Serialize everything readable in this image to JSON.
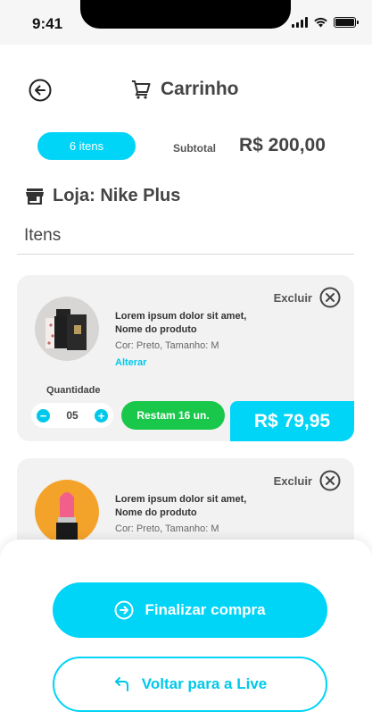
{
  "status_bar": {
    "time": "9:41"
  },
  "header": {
    "title": "Carrinho",
    "back_icon": "arrow-left-circle-icon",
    "cart_icon": "shopping-cart-icon"
  },
  "summary": {
    "items_count": "6 itens",
    "subtotal_label": "Subtotal",
    "subtotal_value": "R$ 200,00"
  },
  "store": {
    "name": "Loja: Nike Plus",
    "icon": "store-icon"
  },
  "items_heading": "Itens",
  "colors": {
    "accent": "#00d4f7",
    "success": "#19c84a",
    "card_bg": "#f2f2f2",
    "text": "#444444"
  },
  "cart_items": [
    {
      "name": "Lorem ipsum dolor sit amet, Nome do produto",
      "variant": "Cor: Preto, Tamanho: M",
      "edit_label": "Alterar",
      "remove_label": "Excluir",
      "quantity_label": "Quantidade",
      "quantity": "05",
      "stock_label": "Restam 16 un.",
      "price": "R$ 79,95",
      "image": "perfume-box-product"
    },
    {
      "name": "Lorem ipsum dolor sit amet, Nome do produto",
      "variant": "Cor: Preto, Tamanho: M",
      "remove_label": "Excluir",
      "image": "lipstick-product"
    }
  ],
  "actions": {
    "checkout_label": "Finalizar compra",
    "checkout_icon": "arrow-right-circle-icon",
    "back_live_label": "Voltar para a Live",
    "back_live_icon": "return-arrow-icon"
  }
}
